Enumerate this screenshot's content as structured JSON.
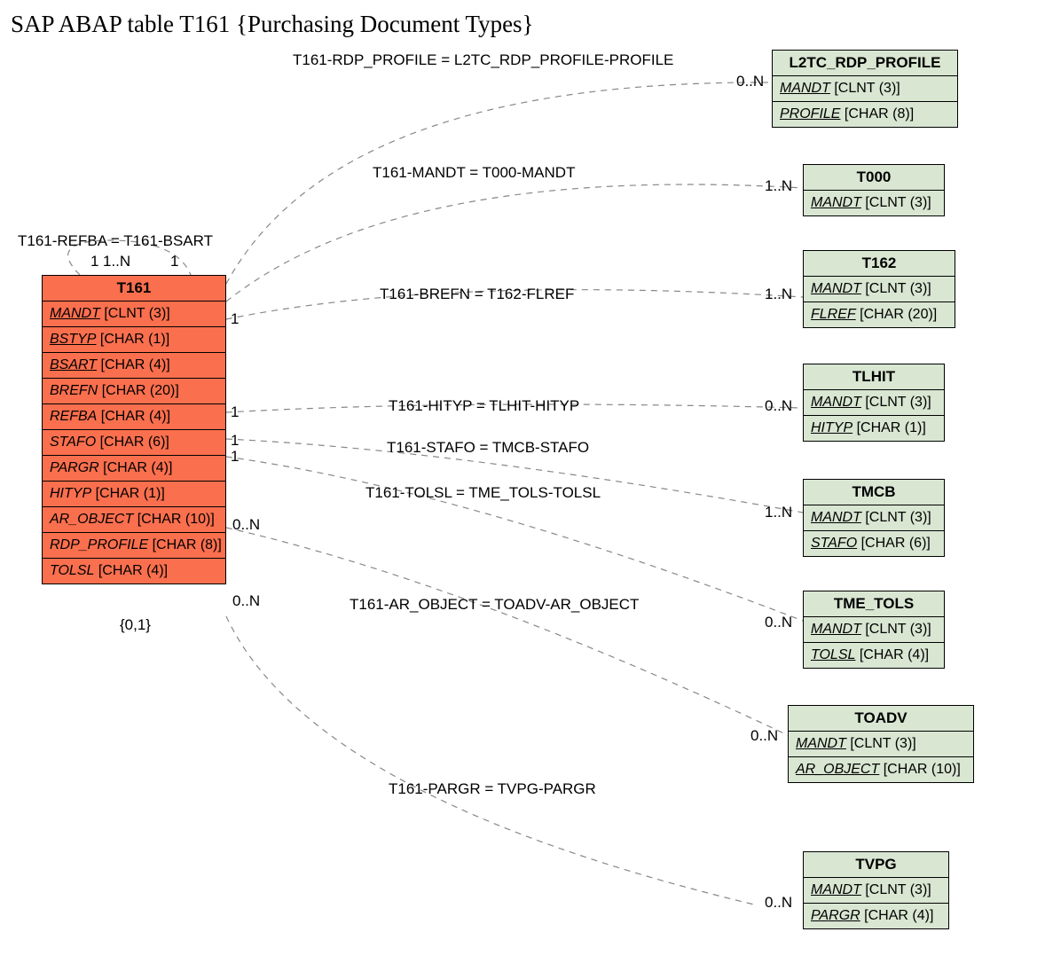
{
  "title": "SAP ABAP table T161 {Purchasing Document Types}",
  "main_entity": {
    "name": "T161",
    "fields": [
      {
        "name": "MANDT",
        "type": "[CLNT (3)]",
        "key": true
      },
      {
        "name": "BSTYP",
        "type": "[CHAR (1)]",
        "key": true
      },
      {
        "name": "BSART",
        "type": "[CHAR (4)]",
        "key": true
      },
      {
        "name": "BREFN",
        "type": "[CHAR (20)]",
        "key": false
      },
      {
        "name": "REFBA",
        "type": "[CHAR (4)]",
        "key": false
      },
      {
        "name": "STAFO",
        "type": "[CHAR (6)]",
        "key": false
      },
      {
        "name": "PARGR",
        "type": "[CHAR (4)]",
        "key": false
      },
      {
        "name": "HITYP",
        "type": "[CHAR (1)]",
        "key": false
      },
      {
        "name": "AR_OBJECT",
        "type": "[CHAR (10)]",
        "key": false
      },
      {
        "name": "RDP_PROFILE",
        "type": "[CHAR (8)]",
        "key": false
      },
      {
        "name": "TOLSL",
        "type": "[CHAR (4)]",
        "key": false
      }
    ],
    "below_label": "{0,1}"
  },
  "self_ref": {
    "label": "T161-REFBA = T161-BSART",
    "card_left": "1",
    "card_mid": "1..N",
    "card_right": "1"
  },
  "related_entities": [
    {
      "name": "L2TC_RDP_PROFILE",
      "fields": [
        {
          "name": "MANDT",
          "type": "[CLNT (3)]",
          "key": true
        },
        {
          "name": "PROFILE",
          "type": "[CHAR (8)]",
          "key": true
        }
      ]
    },
    {
      "name": "T000",
      "fields": [
        {
          "name": "MANDT",
          "type": "[CLNT (3)]",
          "key": true
        }
      ]
    },
    {
      "name": "T162",
      "fields": [
        {
          "name": "MANDT",
          "type": "[CLNT (3)]",
          "key": true
        },
        {
          "name": "FLREF",
          "type": "[CHAR (20)]",
          "key": true
        }
      ]
    },
    {
      "name": "TLHIT",
      "fields": [
        {
          "name": "MANDT",
          "type": "[CLNT (3)]",
          "key": true
        },
        {
          "name": "HITYP",
          "type": "[CHAR (1)]",
          "key": true
        }
      ]
    },
    {
      "name": "TMCB",
      "fields": [
        {
          "name": "MANDT",
          "type": "[CLNT (3)]",
          "key": true
        },
        {
          "name": "STAFO",
          "type": "[CHAR (6)]",
          "key": true
        }
      ]
    },
    {
      "name": "TME_TOLS",
      "fields": [
        {
          "name": "MANDT",
          "type": "[CLNT (3)]",
          "key": true
        },
        {
          "name": "TOLSL",
          "type": "[CHAR (4)]",
          "key": true
        }
      ]
    },
    {
      "name": "TOADV",
      "fields": [
        {
          "name": "MANDT",
          "type": "[CLNT (3)]",
          "key": true
        },
        {
          "name": "AR_OBJECT",
          "type": "[CHAR (10)]",
          "key": true
        }
      ]
    },
    {
      "name": "TVPG",
      "fields": [
        {
          "name": "MANDT",
          "type": "[CLNT (3)]",
          "key": true
        },
        {
          "name": "PARGR",
          "type": "[CHAR (4)]",
          "key": true
        }
      ]
    }
  ],
  "relations": [
    {
      "label": "T161-RDP_PROFILE = L2TC_RDP_PROFILE-PROFILE",
      "left_card": "",
      "right_card": "0..N"
    },
    {
      "label": "T161-MANDT = T000-MANDT",
      "left_card": "",
      "right_card": "1..N"
    },
    {
      "label": "T161-BREFN = T162-FLREF",
      "left_card": "1",
      "right_card": "1..N"
    },
    {
      "label": "T161-HITYP = TLHIT-HITYP",
      "left_card": "1",
      "right_card": "0..N"
    },
    {
      "label": "T161-STAFO = TMCB-STAFO",
      "left_card": "1",
      "right_card": ""
    },
    {
      "label": "T161-TOLSL = TME_TOLS-TOLSL",
      "left_card": "1",
      "right_card": "1..N"
    },
    {
      "label": "T161-AR_OBJECT = TOADV-AR_OBJECT",
      "left_card": "0..N",
      "right_card": "0..N"
    },
    {
      "label": "T161-PARGR = TVPG-PARGR",
      "left_card": "0..N",
      "right_card": "0..N"
    }
  ],
  "right_card_tmcb_extra": "0..N"
}
